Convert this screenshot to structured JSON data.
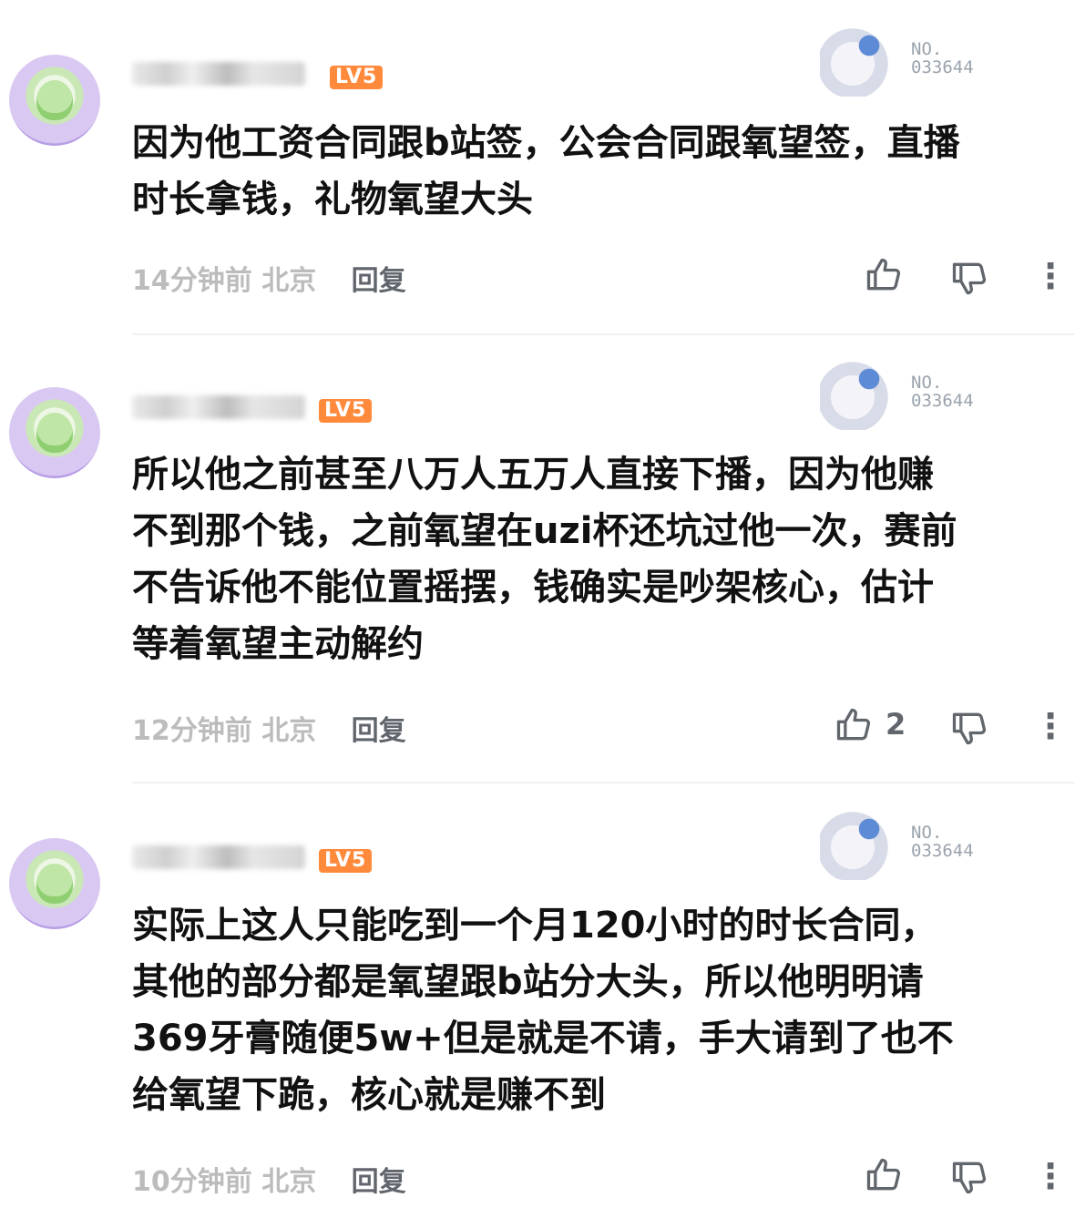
{
  "comments": [
    {
      "level": "LV5",
      "badge_no_label": "NO.",
      "badge_no_value": "033644",
      "text_lines": [
        "因为他工资合同跟b站签，公会合同跟氧望签，直播",
        "时长拿钱，礼物氧望大头"
      ],
      "time": "14分钟前",
      "location": "北京",
      "reply_label": "回复",
      "likes": ""
    },
    {
      "level": "LV5",
      "badge_no_label": "NO.",
      "badge_no_value": "033644",
      "text_lines": [
        "所以他之前甚至八万人五万人直接下播，因为他赚",
        "不到那个钱，之前氧望在uzi杯还坑过他一次，赛前",
        "不告诉他不能位置摇摆，钱确实是吵架核心，估计",
        "等着氧望主动解约"
      ],
      "time": "12分钟前",
      "location": "北京",
      "reply_label": "回复",
      "likes": "2"
    },
    {
      "level": "LV5",
      "badge_no_label": "NO.",
      "badge_no_value": "033644",
      "text_lines": [
        "实际上这人只能吃到一个月120小时的时长合同，",
        "其他的部分都是氧望跟b站分大头，所以他明明请",
        "369牙膏随便5w+但是就是不请，手大请到了也不",
        "给氧望下跪，核心就是赚不到"
      ],
      "time": "10分钟前",
      "location": "北京",
      "reply_label": "回复",
      "likes": ""
    }
  ],
  "icons": {
    "like": "thumb-up-icon",
    "dislike": "thumb-down-icon",
    "more": "more-vertical-icon"
  },
  "colors": {
    "level_badge": "#ff8a3c",
    "meta_text": "#bcbcbc",
    "action_icon": "#61666d",
    "divider": "#f1f2f3"
  }
}
